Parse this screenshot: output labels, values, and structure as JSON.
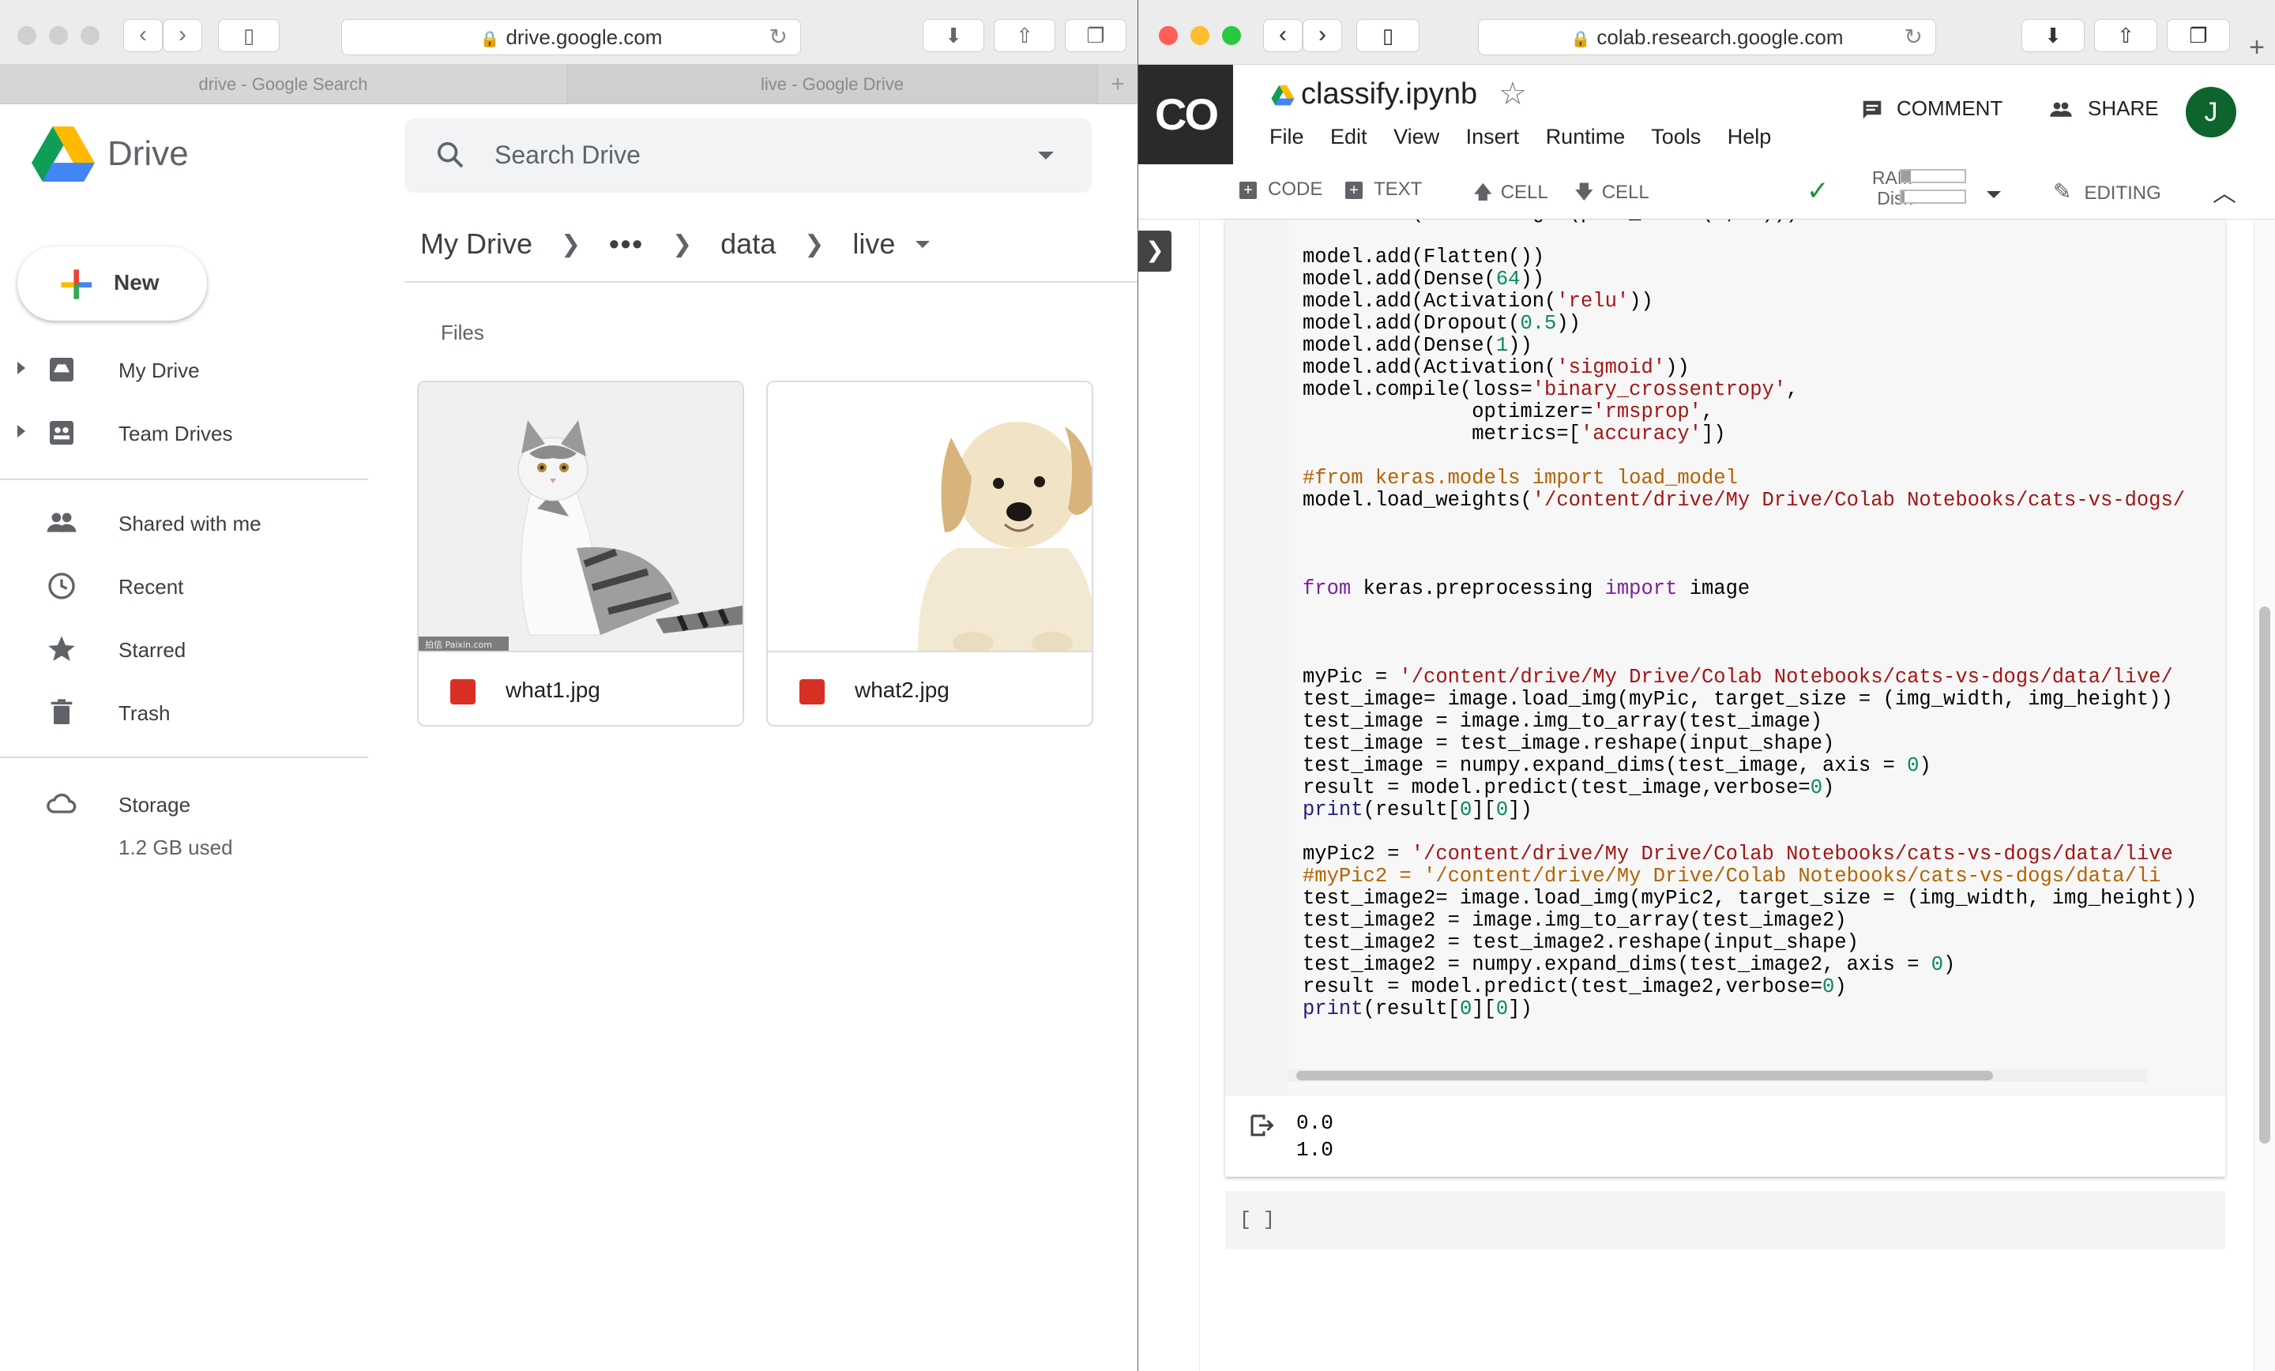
{
  "drive_window": {
    "url": "drive.google.com",
    "tabs": [
      "drive - Google Search",
      "live - Google Drive"
    ],
    "app_name": "Drive",
    "search_placeholder": "Search Drive",
    "new_label": "New",
    "sidebar": [
      {
        "label": "My Drive",
        "icon": "my-drive-icon",
        "expandable": true
      },
      {
        "label": "Team Drives",
        "icon": "team-drives-icon",
        "expandable": true
      },
      {
        "label": "Shared with me",
        "icon": "people-icon"
      },
      {
        "label": "Recent",
        "icon": "clock-icon"
      },
      {
        "label": "Starred",
        "icon": "star-icon"
      },
      {
        "label": "Trash",
        "icon": "trash-icon"
      }
    ],
    "storage": {
      "label": "Storage",
      "used": "1.2 GB used"
    },
    "breadcrumb": {
      "root": "My Drive",
      "more": "•••",
      "folder1": "data",
      "current": "live"
    },
    "files_heading": "Files",
    "files": [
      {
        "name": "what1.jpg",
        "thumb": "cat",
        "watermark": "拍信 Paixin.com"
      },
      {
        "name": "what2.jpg",
        "thumb": "dog"
      }
    ]
  },
  "colab_window": {
    "url": "colab.research.google.com",
    "logo": "CO",
    "title": "classify.ipynb",
    "menu": [
      "File",
      "Edit",
      "View",
      "Insert",
      "Runtime",
      "Tools",
      "Help"
    ],
    "comment_label": "COMMENT",
    "share_label": "SHARE",
    "avatar_letter": "J",
    "toolbar": {
      "code": "CODE",
      "text": "TEXT",
      "cell_up": "CELL",
      "cell_down": "CELL",
      "ram": "RAM",
      "disk": "Disk",
      "ram_level": 0.15,
      "disk_level": 0.05,
      "editing": "EDITING"
    },
    "output_lines": [
      "0.0",
      "1.0"
    ],
    "empty_cell_brackets": "[ ]",
    "accent": "#f9ab00"
  }
}
